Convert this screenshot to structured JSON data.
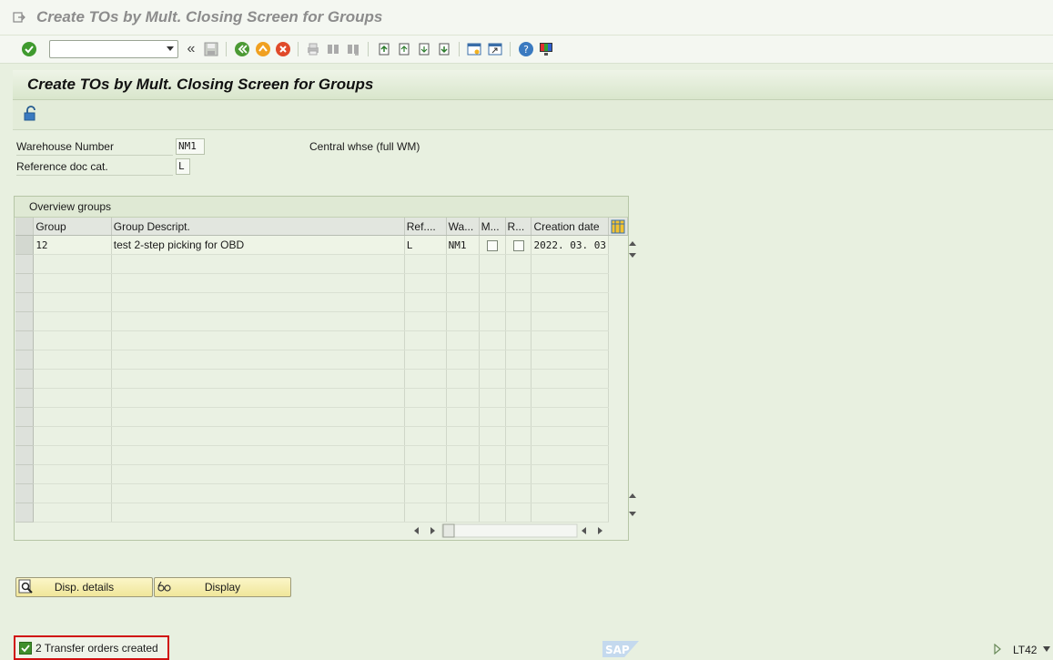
{
  "window": {
    "title": "Create TOs by Mult. Closing Screen for Groups"
  },
  "screen": {
    "header": "Create TOs by Mult. Closing Screen for Groups"
  },
  "fields": {
    "warehouse_label": "Warehouse Number",
    "warehouse_value": "NM1",
    "warehouse_desc": "Central whse (full WM)",
    "refdoc_label": "Reference doc cat.",
    "refdoc_value": "L"
  },
  "overview": {
    "title": "Overview groups",
    "columns": [
      "Group",
      "Group Descript.",
      "Ref....",
      "Wa...",
      "M...",
      "R...",
      "Creation date"
    ],
    "rows": [
      {
        "group": "12",
        "descr": "test 2-step picking for OBD",
        "ref": "L",
        "wa": "NM1",
        "m": false,
        "r": false,
        "date": "2022. 03. 03"
      }
    ]
  },
  "buttons": {
    "details": "Disp. details",
    "display": "Display"
  },
  "status": {
    "message": "2 Transfer orders created",
    "transaction": "LT42"
  },
  "branding": {
    "logo": "SAP"
  },
  "colors": {
    "background": "#e8f0e0",
    "status_border": "#d01010",
    "button_bg": "#f0e69a",
    "ok_green": "#3f8f2c"
  },
  "icons": [
    "enter-icon",
    "cmd-dropdown-icon",
    "save-icon",
    "back-icon",
    "exit-icon",
    "cancel-icon",
    "print-icon",
    "find-icon",
    "find-next-icon",
    "first-page-icon",
    "prev-page-icon",
    "next-page-icon",
    "last-page-icon",
    "new-session-icon",
    "shortcut-icon",
    "help-icon",
    "customize-icon",
    "unlock-icon"
  ]
}
